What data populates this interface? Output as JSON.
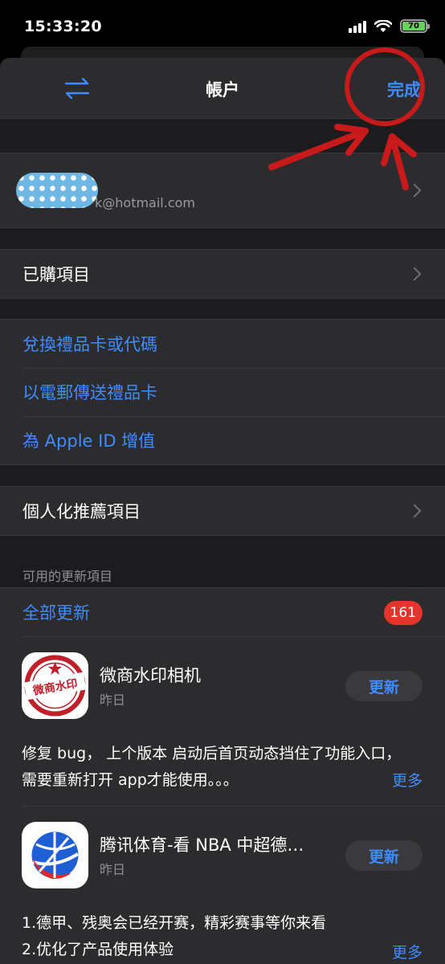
{
  "status_bar": {
    "time": "15:33:20",
    "battery": "70"
  },
  "nav": {
    "title": "帳户",
    "done": "完成"
  },
  "account": {
    "email": "k@hotmail.com"
  },
  "menu": {
    "purchased": "已購項目",
    "redeem": "兌換禮品卡或代碼",
    "send_gift": "以電郵傳送禮品卡",
    "add_funds": "為 Apple ID 增值",
    "personalized": "個人化推薦項目"
  },
  "updates": {
    "section_header": "可用的更新項目",
    "update_all": "全部更新",
    "count": "161",
    "apps": [
      {
        "name": "微商水印相机",
        "date": "昨日",
        "button": "更新",
        "icon_text": "微商水印",
        "notes_line1": "修复 bug， 上个版本 启动后首页动态挡住了功能入口，",
        "notes_line2": "需要重新打开 app才能使用。。。",
        "more": "更多"
      },
      {
        "name": "腾讯体育-看 NBA 中超德…",
        "date": "昨日",
        "button": "更新",
        "notes_line1": "1.德甲、残奥会已经开赛，精彩赛事等你来看",
        "notes_line2": "2.优化了产品使用体验",
        "more": "更多"
      }
    ]
  },
  "colors": {
    "accent": "#3f8cff",
    "badge": "#e5342b",
    "annotation": "#c8191b"
  }
}
